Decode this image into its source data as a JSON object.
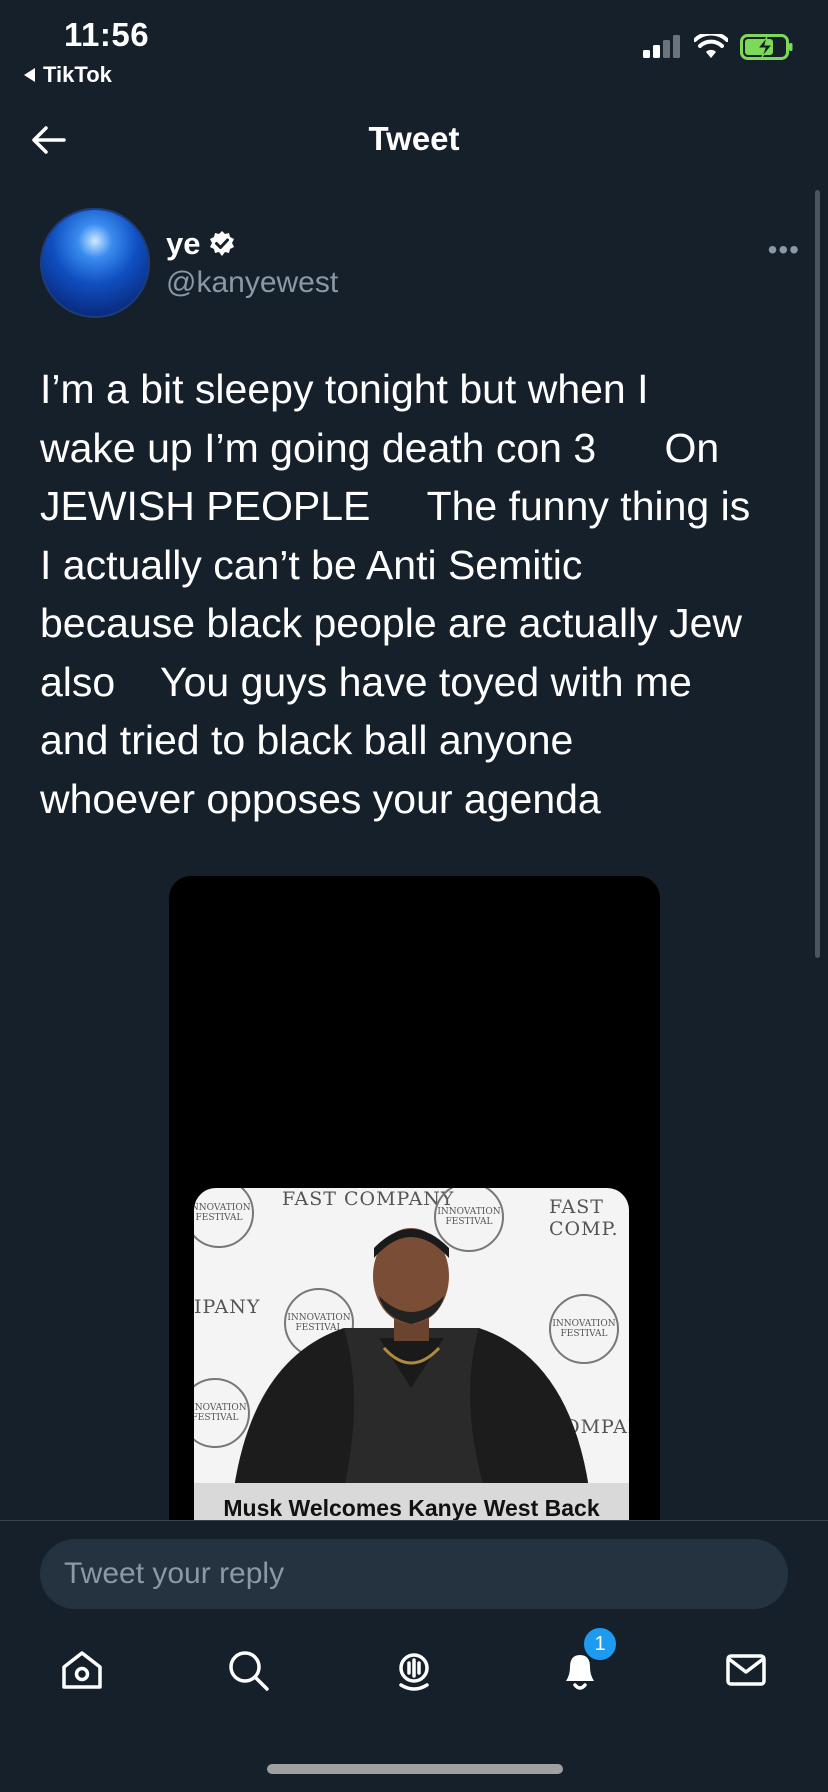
{
  "status_bar": {
    "time": "11:56",
    "back_app": "TikTok",
    "battery_color": "#7ed957"
  },
  "header": {
    "title": "Tweet"
  },
  "tweet": {
    "author_name": "ye",
    "verified": true,
    "handle": "@kanyewest",
    "text": "I’m a bit sleepy tonight but when I\nwake up I’m going death con 3      On\nJEWISH PEOPLE     The funny thing is\nI actually can’t be Anti Semitic\nbecause black people are actually Jew\nalso    You guys have toyed with me\nand tried to black ball anyone\nwhoever opposes your agenda",
    "media": {
      "caption": "Musk Welcomes Kanye West Back",
      "backdrop_logos": [
        "FAST COMPANY",
        "FAST COMP.",
        "IPANY",
        "OMPANY",
        "INNOVATION FESTIVAL"
      ]
    }
  },
  "reply": {
    "placeholder": "Tweet your reply"
  },
  "tabbar": {
    "notifications_badge": "1",
    "icons": [
      "home-icon",
      "search-icon",
      "spaces-icon",
      "notifications-icon",
      "messages-icon"
    ]
  },
  "colors": {
    "background": "#15202b",
    "accent": "#1d9bf0",
    "muted_text": "#8b98a5"
  }
}
